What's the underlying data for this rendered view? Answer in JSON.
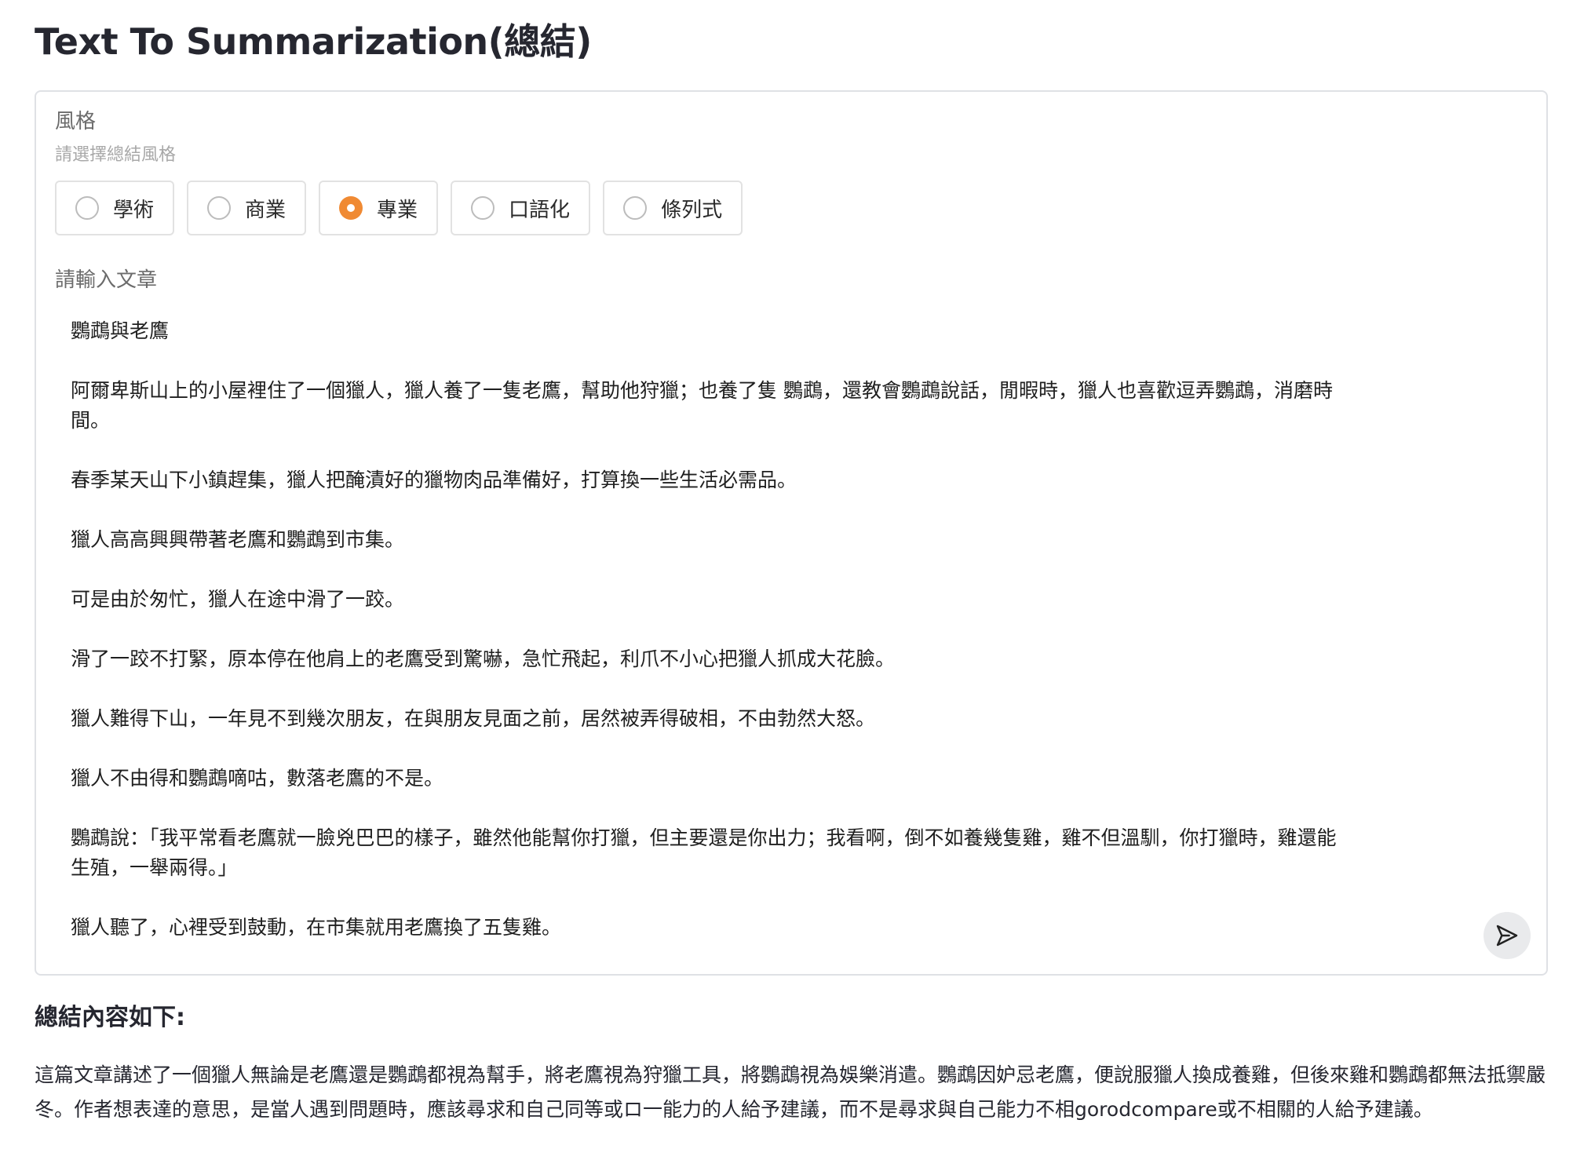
{
  "page": {
    "title": "Text To Summarization(總結)"
  },
  "style_field": {
    "label": "風格",
    "sublabel": "請選擇總結風格",
    "options": [
      {
        "label": "學術",
        "selected": false
      },
      {
        "label": "商業",
        "selected": false
      },
      {
        "label": "專業",
        "selected": true
      },
      {
        "label": "口語化",
        "selected": false
      },
      {
        "label": "條列式",
        "selected": false
      }
    ],
    "accent_color": "#f08a33"
  },
  "article_field": {
    "label": "請輸入文章",
    "value": "鸚鵡與老鷹\n\n阿爾卑斯山上的小屋裡住了一個獵人，獵人養了一隻老鷹，幫助他狩獵；也養了隻 鸚鵡，還教會鸚鵡說話，閒暇時，獵人也喜歡逗弄鸚鵡，消磨時\n間。\n\n春季某天山下小鎮趕集，獵人把醃漬好的獵物肉品準備好，打算換一些生活必需品。\n\n獵人高高興興帶著老鷹和鸚鵡到市集。\n\n可是由於匆忙，獵人在途中滑了一跤。\n\n滑了一跤不打緊，原本停在他肩上的老鷹受到驚嚇，急忙飛起，利爪不小心把獵人抓成大花臉。\n\n獵人難得下山，一年見不到幾次朋友，在與朋友見面之前，居然被弄得破相，不由勃然大怒。\n\n獵人不由得和鸚鵡嘀咕，數落老鷹的不是。\n\n鸚鵡說：「我平常看老鷹就一臉兇巴巴的樣子，雖然他能幫你打獵，但主要還是你出力；我看啊，倒不如養幾隻雞，雞不但溫馴，你打獵時，雞還能\n生殖，一舉兩得。」\n\n獵人聽了，心裡受到鼓動，在市集就用老鷹換了五隻雞。",
    "send_icon": "send-icon"
  },
  "summary": {
    "heading": "總結內容如下:",
    "body": "這篇文章講述了一個獵人無論是老鷹還是鸚鵡都視為幫手，將老鷹視為狩獵工具，將鸚鵡視為娛樂消遣。鸚鵡因妒忌老鷹，便說服獵人換成養雞，但後來雞和鸚鵡都無法抵禦嚴冬。作者想表達的意思，是當人遇到問題時，應該尋求和自己同等或ロ一能力的人給予建議，而不是尋求與自己能力不相gorodcompare或不相關的人給予建議。"
  }
}
